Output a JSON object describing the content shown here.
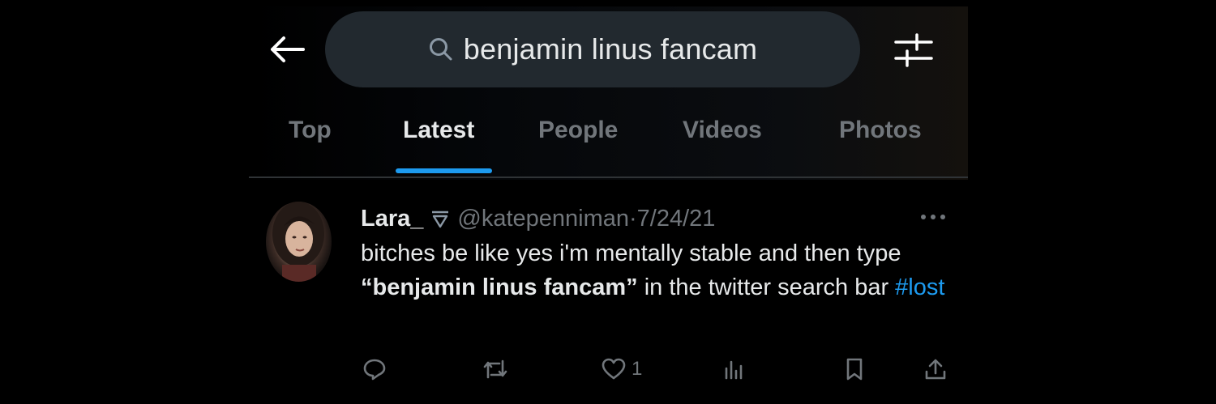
{
  "header": {
    "back_icon": "arrow-left-icon",
    "search": {
      "icon": "search-icon",
      "query": "benjamin linus fancam"
    },
    "filter_icon": "sliders-icon"
  },
  "tabs": [
    {
      "label": "Top",
      "active": false
    },
    {
      "label": "Latest",
      "active": true
    },
    {
      "label": "People",
      "active": false
    },
    {
      "label": "Videos",
      "active": false
    },
    {
      "label": "Photos",
      "active": false
    }
  ],
  "tweet": {
    "display_name": "Lara_",
    "badge_icon": "triangle-emoji-icon",
    "handle_date": "@katepenniman·7/24/21",
    "text_before": "bitches be like yes i'm mentally stable and then type ",
    "text_bold": "“benjamin linus fancam”",
    "text_after": " in the twitter search bar ",
    "hashtag": "#lost",
    "actions": {
      "reply_icon": "reply-icon",
      "retweet_icon": "retweet-icon",
      "like_icon": "heart-icon",
      "like_count": "1",
      "views_icon": "bar-chart-icon",
      "bookmark_icon": "bookmark-icon",
      "share_icon": "share-icon"
    }
  },
  "colors": {
    "accent": "#1d9bf0",
    "background": "#000000",
    "search_bg": "#22292f",
    "muted_text": "#71767b",
    "primary_text": "#e7e9ea"
  }
}
